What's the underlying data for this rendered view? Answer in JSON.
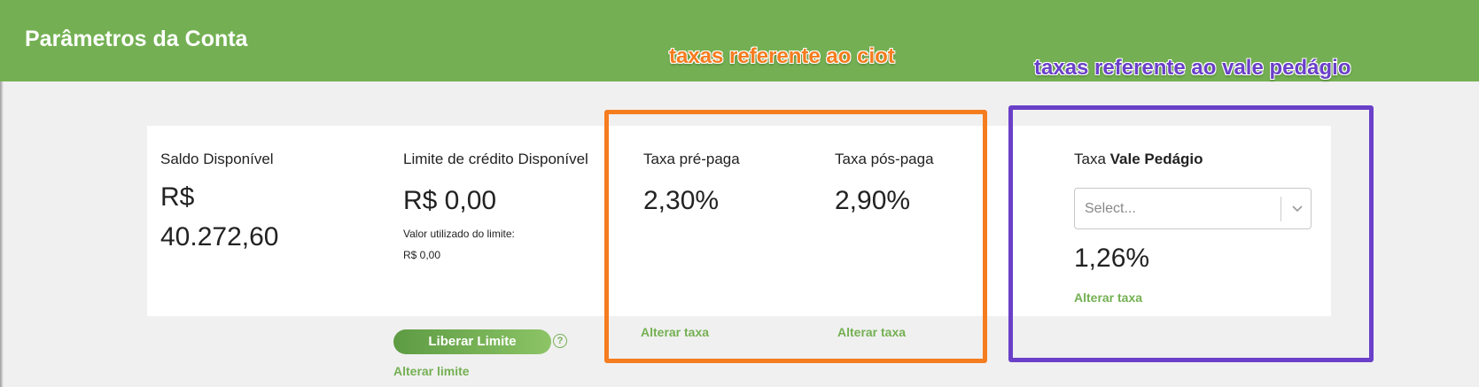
{
  "header": {
    "title": "Parâmetros da Conta"
  },
  "annotations": {
    "ciot": "taxas referente ao ciot",
    "vale": "taxas referente ao vale pedágio"
  },
  "saldo": {
    "label": "Saldo Disponível",
    "value_line1": "R$",
    "value_line2": "40.272,60"
  },
  "limite": {
    "label": "Limite de crédito Disponível",
    "value": "R$ 0,00",
    "used_label": "Valor utilizado do limite:",
    "used_value": "R$ 0,00",
    "liberar_button": "Liberar Limite",
    "alterar_link": "Alterar limite"
  },
  "taxa_pre": {
    "label": "Taxa pré-paga",
    "value": "2,30%",
    "alterar_link": "Alterar taxa"
  },
  "taxa_pos": {
    "label": "Taxa pós-paga",
    "value": "2,90%",
    "alterar_link": "Alterar taxa"
  },
  "vale_pedagio": {
    "label_prefix": "Taxa ",
    "label_bold": "Vale Pedágio",
    "select_placeholder": "Select...",
    "value": "1,26%",
    "alterar_link": "Alterar taxa"
  },
  "icons": {
    "help": "help-circle-icon",
    "select_arrow": "chevron-down-icon"
  },
  "colors": {
    "header_bg": "#74b053",
    "accent_green": "#74b053",
    "annotation_orange": "#f57c1f",
    "annotation_purple": "#6a40c9",
    "page_bg": "#f0f0f0"
  }
}
